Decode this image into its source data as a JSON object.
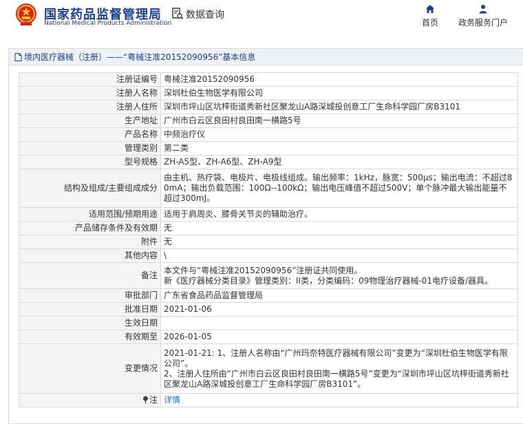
{
  "header": {
    "logo_cn": "国家药品监督管理局",
    "logo_en": "National Medical Products Administration",
    "data_query": "数据查询",
    "nav": {
      "home": "首页",
      "portal": "政务服务门户"
    },
    "icons": {
      "home": "home-icon",
      "portal": "user-icon",
      "query": "search-document-icon",
      "emblem": "national-emblem-icon"
    }
  },
  "breadcrumb": "境内医疗器械（注册）——“粤械注准20152090956”基本信息",
  "rows": [
    {
      "label": "注册证编号",
      "value": "粤械注准20152090956"
    },
    {
      "label": "注册人名称",
      "value": "深圳杜伯生物医学有限公司"
    },
    {
      "label": "注册人住所",
      "value": "深圳市坪山区坑梓街道秀新社区聚龙山A路深城投创意工厂生命科学园厂房B3101"
    },
    {
      "label": "生产地址",
      "value": "广州市白云区良田村良田南一横路5号"
    },
    {
      "label": "产品名称",
      "value": "中频治疗仪"
    },
    {
      "label": "管理类别",
      "value": "第二类"
    },
    {
      "label": "型号规格",
      "value": "ZH-A5型、ZH-A6型、ZH-A9型"
    },
    {
      "label": "结构及组成/主要组成成分",
      "value": "由主机、热疗袋、电极片、电极线组成。输出频率：1kHz，脉宽：500μs；输出电流：不超过80mA；输出负载范围：100Ω--100kΩ；输出电压峰值不超过500V；单个脉冲最大输出能量不超过300mJ。"
    },
    {
      "label": "适用范围/预期用途",
      "value": "适用于肩周炎、膝骨关节炎的辅助治疗。"
    },
    {
      "label": "产品储存条件及有效期",
      "value": "无"
    },
    {
      "label": "附件",
      "value": "无"
    },
    {
      "label": "其他内容",
      "value": "\\"
    },
    {
      "label": "备注",
      "value": "本文件与“粤械注准20152090956”注册证共同使用。\n新《医疗器械分类目录》管理类别：II类，分类编码：09物理治疗器械-01电疗设备/器具。"
    },
    {
      "label": "审批部门",
      "value": "广东省食品药品监督管理局"
    },
    {
      "label": "批准日期",
      "value": "2021-01-06"
    },
    {
      "label": "生效日期",
      "value": ""
    },
    {
      "label": "有效期至",
      "value": "2026-01-05"
    },
    {
      "label": "变更情况",
      "value": "2021-01-21: 1、注册人名称由“广州玛奈特医疗器械有限公司”变更为“深圳杜伯生物医学有限公司”。\n2、注册人住所由“广州市白云区良田村良田南一横路5号”变更为“深圳市坪山区坑梓街道秀新社区聚龙山A路深城投创意工厂生命科学园厂房B3101”。"
    }
  ],
  "note": {
    "label": "注",
    "link": "详情"
  },
  "colors": {
    "brand": "#1a3f8f",
    "link": "#1e6fc8",
    "label_bg": "#f4f4f4",
    "border": "#d9d9d9"
  }
}
